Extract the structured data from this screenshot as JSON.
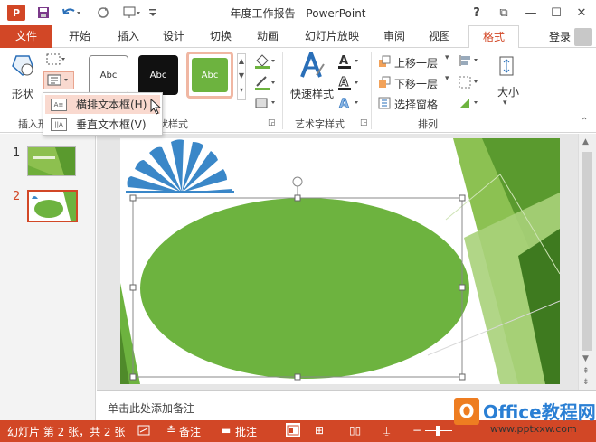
{
  "app": {
    "logo_letter": "P",
    "title": "年度工作报告 - PowerPoint",
    "brand_color": "#d24726"
  },
  "quick_access": {
    "save_icon": "save-icon",
    "undo_icon": "undo-icon",
    "redo_icon": "redo-icon",
    "customize_icon": "customize-icon"
  },
  "window": {
    "help": "?",
    "restore": "⧉",
    "minimize": "—",
    "maximize": "☐",
    "close": "✕"
  },
  "tabs": [
    {
      "label": "文件"
    },
    {
      "label": "开始"
    },
    {
      "label": "插入"
    },
    {
      "label": "设计"
    },
    {
      "label": "切换"
    },
    {
      "label": "动画"
    },
    {
      "label": "幻灯片放映"
    },
    {
      "label": "审阅"
    },
    {
      "label": "视图"
    },
    {
      "label": "格式"
    }
  ],
  "login_label": "登录",
  "ribbon": {
    "shapes_label": "形状",
    "insert_shapes_group": "插入形",
    "style_samples": [
      "Abc",
      "Abc",
      "Abc"
    ],
    "shape_styles_group": "状样式",
    "quick_styles_label": "快速样式",
    "art_styles_group": "艺术字样式",
    "bring_forward": "上移一层",
    "send_backward": "下移一层",
    "selection_pane": "选择窗格",
    "arrange_group": "排列",
    "size_label": "大小"
  },
  "dropdown": {
    "items": [
      {
        "label": "横排文本框(H)",
        "highlighted": true
      },
      {
        "label": "垂直文本框(V)",
        "highlighted": false
      }
    ]
  },
  "thumbnails": [
    {
      "number": "1",
      "selected": false
    },
    {
      "number": "2",
      "selected": true
    }
  ],
  "notes_placeholder": "单击此处添加备注",
  "status": {
    "slide_info": "幻灯片 第 2 张，共 2 张",
    "notes": "备注",
    "comments": "批注",
    "zoom_minus": "−",
    "zoom_plus": "+"
  },
  "watermark": {
    "logo_letter": "O",
    "title": "Office教程网",
    "url": "www.pptxxw.com"
  },
  "colors": {
    "ellipse_green": "#6db33f",
    "fan_blue": "#3a87c8",
    "accent_green_dark": "#4f8a2a",
    "highlight": "#f9d9cf"
  }
}
